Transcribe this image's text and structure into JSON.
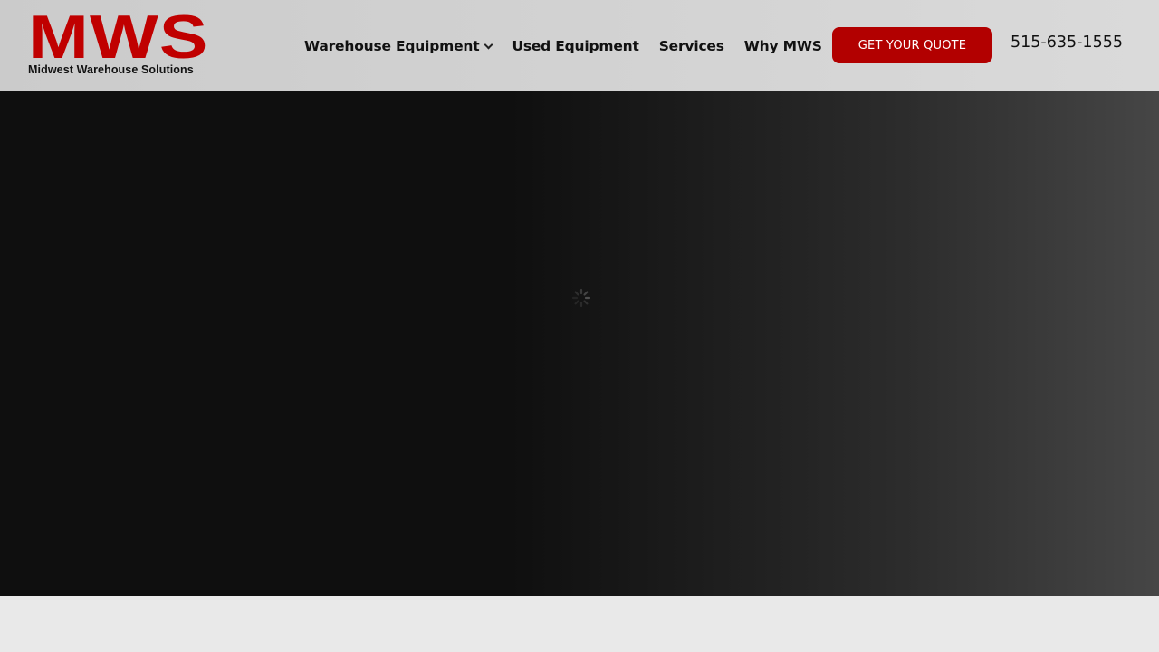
{
  "colors": {
    "brand_red": "#c00000",
    "button_red": "#b20000"
  },
  "header": {
    "logo": {
      "mark": "MWS",
      "tagline": "Midwest Warehouse Solutions"
    },
    "nav": {
      "items": [
        {
          "label": "Warehouse Equipment",
          "has_dropdown": true
        },
        {
          "label": "Used Equipment"
        },
        {
          "label": "Services"
        },
        {
          "label": "Why MWS"
        }
      ]
    },
    "cta_label": "GET YOUR QUOTE",
    "phone": "515-635-1555"
  },
  "hero": {
    "loading_icon": "spinner-icon"
  }
}
